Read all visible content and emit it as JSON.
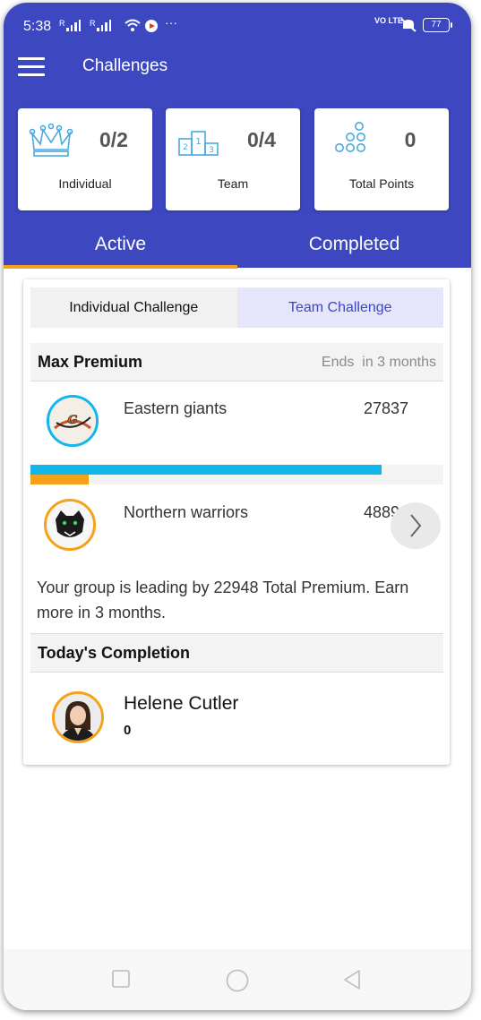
{
  "status_bar": {
    "time": "5:38",
    "signal1_label": "R",
    "signal2_label": "R",
    "volte": "VO LTE",
    "battery": "77",
    "more": "···"
  },
  "header": {
    "title": "Challenges",
    "menu_icon": "hamburger-menu-icon"
  },
  "stats": [
    {
      "value": "0/2",
      "label": "Individual",
      "icon": "crown-icon"
    },
    {
      "value": "0/4",
      "label": "Team",
      "icon": "podium-icon"
    },
    {
      "value": "0",
      "label": "Total Points",
      "icon": "dots-pyramid-icon"
    }
  ],
  "tabs": [
    {
      "label": "Active",
      "selected": true
    },
    {
      "label": "Completed",
      "selected": false
    }
  ],
  "segments": [
    {
      "label": "Individual Challenge",
      "selected": false
    },
    {
      "label": "Team Challenge",
      "selected": true
    }
  ],
  "challenge": {
    "name": "Max Premium",
    "ends_label": "Ends",
    "ends_value": "in 3 months"
  },
  "teams": [
    {
      "name": "Eastern giants",
      "score": "27837",
      "logo": "giants-logo"
    },
    {
      "name": "Northern warriors",
      "score": "4889",
      "logo": "panther-logo"
    }
  ],
  "progress": {
    "team1_fraction": 0.85,
    "team2_fraction": 0.14
  },
  "message": "Your group is leading by 22948 Total Premium. Earn more in 3 months.",
  "completion": {
    "title": "Today's Completion",
    "person_name": "Helene Cutler",
    "person_score": "0"
  },
  "colors": {
    "primary": "#3c47c0",
    "accent": "#f5a11c",
    "progress": "#11b6ea",
    "icon_blue": "#4aa8e0"
  }
}
